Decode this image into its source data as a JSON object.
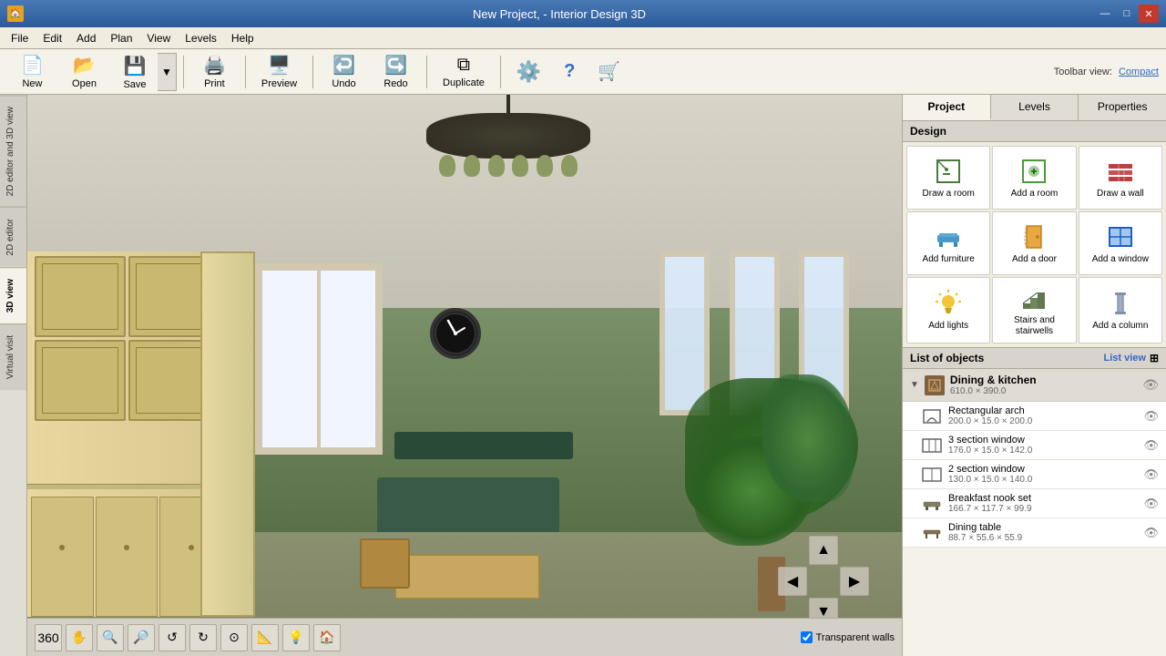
{
  "titlebar": {
    "title": "New Project, - Interior Design 3D",
    "app_icon": "🏠",
    "min_label": "—",
    "max_label": "□",
    "close_label": "✕"
  },
  "menubar": {
    "items": [
      "File",
      "Edit",
      "Add",
      "Plan",
      "View",
      "Levels",
      "Help"
    ]
  },
  "toolbar": {
    "new_label": "New",
    "open_label": "Open",
    "save_label": "Save",
    "print_label": "Print",
    "preview_label": "Preview",
    "undo_label": "Undo",
    "redo_label": "Redo",
    "duplicate_label": "Duplicate",
    "settings_label": "⚙",
    "help_label": "?",
    "store_label": "🛒",
    "toolbar_view_label": "Toolbar view:",
    "compact_label": "Compact"
  },
  "side_tabs": [
    {
      "label": "2D editor and 3D view",
      "active": false
    },
    {
      "label": "2D editor",
      "active": false
    },
    {
      "label": "3D view",
      "active": true
    },
    {
      "label": "Virtual visit",
      "active": false
    }
  ],
  "panel": {
    "tabs": [
      "Project",
      "Levels",
      "Properties"
    ],
    "active_tab": "Project",
    "design_section": "Design",
    "design_buttons": [
      {
        "label": "Draw a room",
        "icon": "✏️"
      },
      {
        "label": "Add a room",
        "icon": "🟩"
      },
      {
        "label": "Draw a wall",
        "icon": "🧱"
      },
      {
        "label": "Add furniture",
        "icon": "🪑"
      },
      {
        "label": "Add a door",
        "icon": "🚪"
      },
      {
        "label": "Add a window",
        "icon": "🪟"
      },
      {
        "label": "Add lights",
        "icon": "💡"
      },
      {
        "label": "Stairs and stairwells",
        "icon": "🪜"
      },
      {
        "label": "Add a column",
        "icon": "🏛️"
      }
    ],
    "list_header": "List of objects",
    "list_view_label": "List view",
    "objects": {
      "group": {
        "name": "Dining & kitchen",
        "dims": "610.0 × 390.0",
        "icon": "⬡"
      },
      "items": [
        {
          "name": "Rectangular arch",
          "dims": "200.0 × 15.0 × 200.0",
          "icon": "⬜"
        },
        {
          "name": "3 section window",
          "dims": "176.0 × 15.0 × 142.0",
          "icon": "⬜"
        },
        {
          "name": "2 section window",
          "dims": "130.0 × 15.0 × 140.0",
          "icon": "⬜"
        },
        {
          "name": "Breakfast nook set",
          "dims": "166.7 × 117.7 × 99.9",
          "icon": "🪑"
        },
        {
          "name": "Dining table",
          "dims": "88.7 × 55.6 × 55.9",
          "icon": "🪑"
        }
      ]
    }
  },
  "nav_buttons": [
    "🔄",
    "✋",
    "🔍",
    "🔎",
    "↩️",
    "↪️",
    "⬜",
    "☁️",
    "💡",
    "🏠"
  ],
  "transparent_walls_label": "Transparent walls",
  "viewport": {
    "zoom_out": "−",
    "zoom_in": "+",
    "rotate_left": "↺",
    "rotate_right": "↻",
    "reset": "⊙",
    "pan": "✋"
  }
}
